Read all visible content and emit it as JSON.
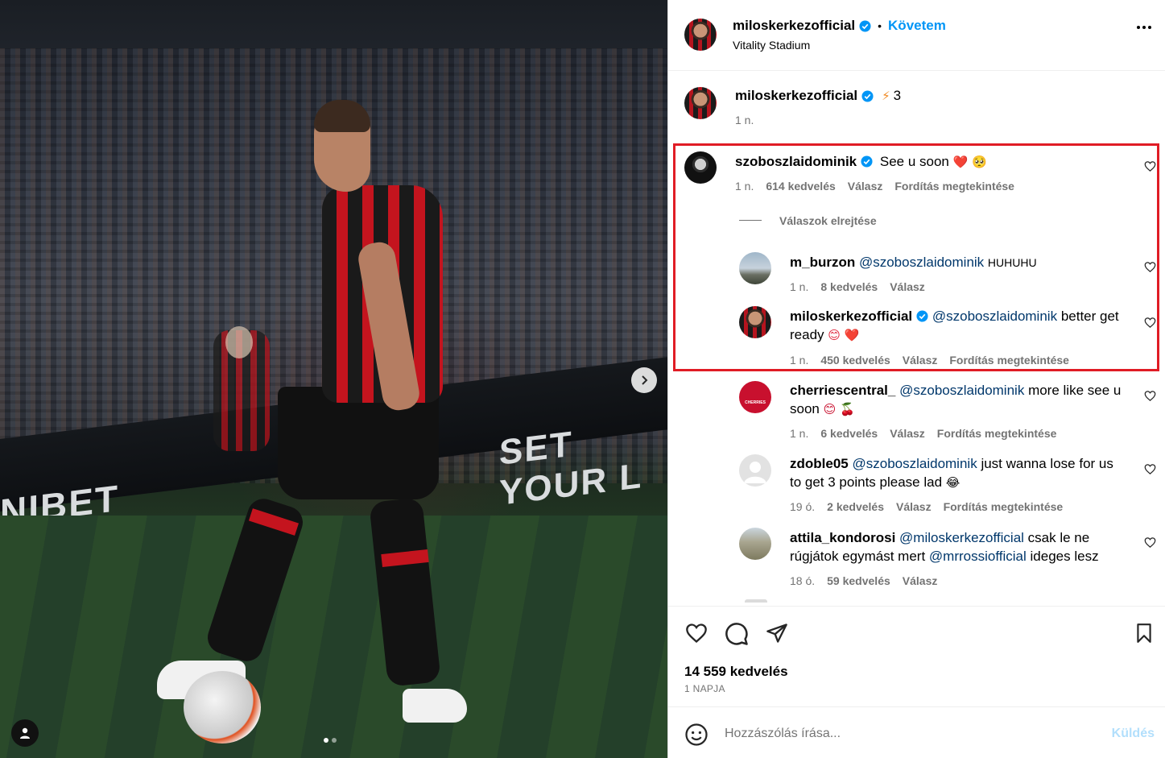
{
  "post": {
    "author": "miloskerkezofficial",
    "separator": "•",
    "follow_label": "Követem",
    "location": "Vitality Stadium",
    "caption_text": "3",
    "caption_emoji": "⚡",
    "caption_time": "1 n."
  },
  "photo": {
    "board_text_left": "NIBET",
    "board_text_right": "SET YOUR L",
    "next_icon": "chevron-right-icon",
    "user_tag_icon": "person-icon",
    "slide_count": 2,
    "active_slide": 1
  },
  "comments": [
    {
      "user": "szoboszlaidominik",
      "verified": true,
      "text": "See u soon",
      "emoji": "❤️ 🥺",
      "time": "1 n.",
      "likes": "614 kedvelés",
      "reply": "Válasz",
      "translate": "Fordítás megtekintése",
      "hide_replies": "Válaszok elrejtése",
      "replies": [
        {
          "user": "m_burzon",
          "mention": "@szoboszlaidominik",
          "text": "HUHUHU",
          "time": "1 n.",
          "likes": "8 kedvelés",
          "reply": "Válasz"
        },
        {
          "user": "miloskerkezofficial",
          "verified": true,
          "mention": "@szoboszlaidominik",
          "text_line1": "better get",
          "text_line2": "ready",
          "emoji": "😊 ❤️",
          "time": "1 n.",
          "likes": "450 kedvelés",
          "reply": "Válasz",
          "translate": "Fordítás megtekintése"
        }
      ]
    },
    {
      "user": "cherriescentral_",
      "mention": "@szoboszlaidominik",
      "text_line1": "more like see u",
      "text_line2": "soon",
      "emoji": "😊 🍒",
      "time": "1 n.",
      "likes": "6 kedvelés",
      "reply": "Válasz",
      "translate": "Fordítás megtekintése",
      "avatar_text": "CHERRIES"
    },
    {
      "user": "zdoble05",
      "mention": "@szoboszlaidominik",
      "text_line1": "just wanna lose for us",
      "text_line2": "to get 3 points please lad",
      "emoji": "😂",
      "time": "19 ó.",
      "likes": "2 kedvelés",
      "reply": "Válasz",
      "translate": "Fordítás megtekintése"
    },
    {
      "user": "attila_kondorosi",
      "mention": "@miloskerkezofficial",
      "text_line1": "csak le ne",
      "text_line2_pre": "rúgjátok egymást mert",
      "mention2": "@mrrossiofficial",
      "text_line2_post": "ideges lesz",
      "time": "18 ó.",
      "likes": "59 kedvelés",
      "reply": "Válasz"
    }
  ],
  "actions": {
    "like_icon": "heart-icon",
    "comment_icon": "comment-icon",
    "share_icon": "send-icon",
    "save_icon": "bookmark-icon",
    "likes_count": "14 559 kedvelés",
    "posted_ago": "1 NAPJA"
  },
  "composer": {
    "emoji_icon": "smiley-icon",
    "placeholder": "Hozzászólás írása...",
    "send_label": "Küldés"
  },
  "colors": {
    "accent": "#0095f6",
    "highlight": "#e01c25",
    "muted": "#737373",
    "mention": "#00376b",
    "verified": "#0095f6"
  }
}
